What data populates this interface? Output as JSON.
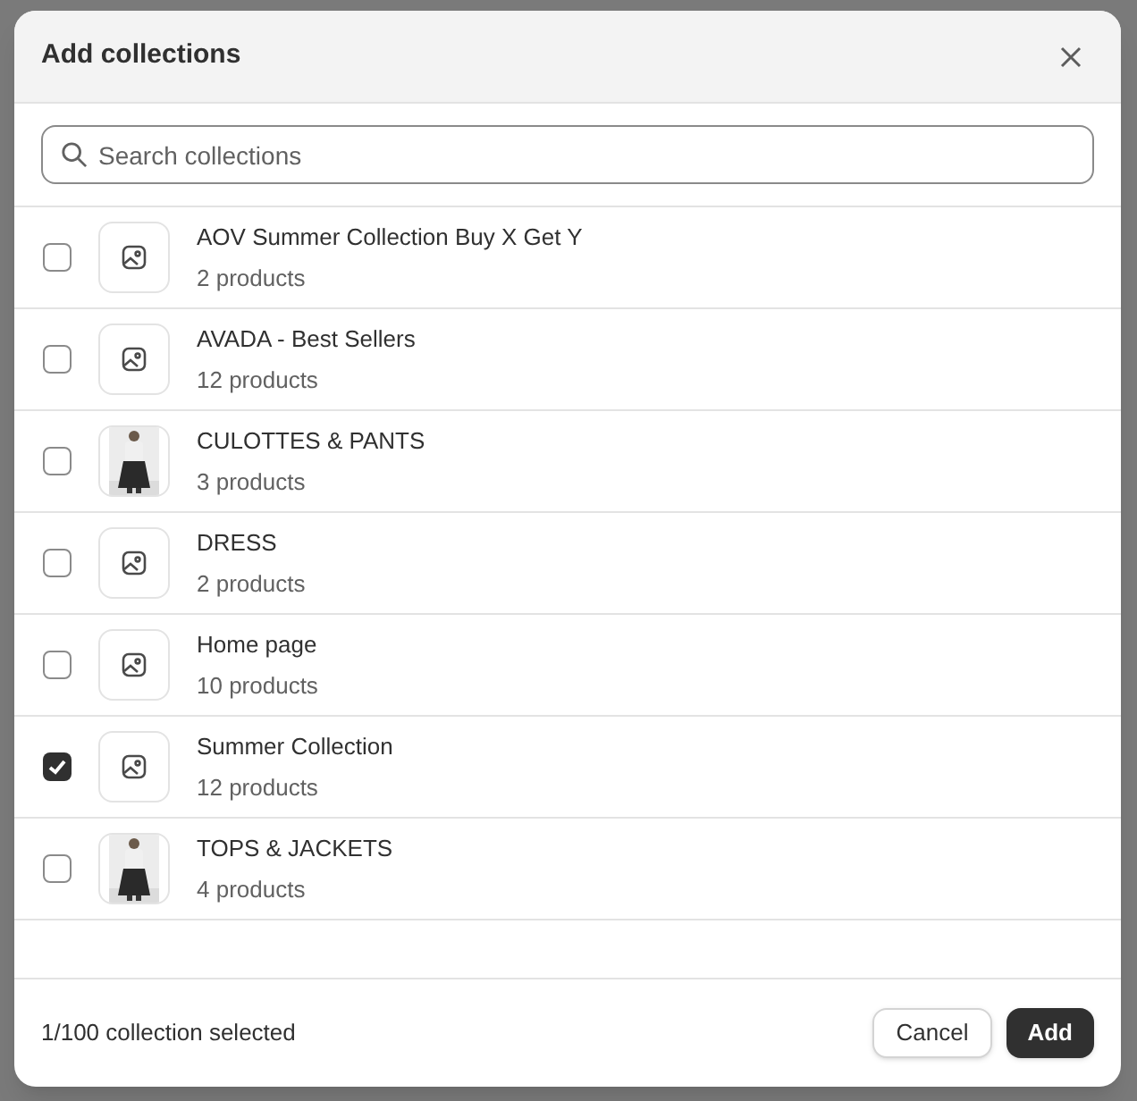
{
  "dialog": {
    "title": "Add collections"
  },
  "search": {
    "placeholder": "Search collections"
  },
  "collections": [
    {
      "name": "AOV Summer Collection Buy X Get Y",
      "count": "2 products",
      "checked": false,
      "kind": "placeholder"
    },
    {
      "name": "AVADA - Best Sellers",
      "count": "12 products",
      "checked": false,
      "kind": "placeholder"
    },
    {
      "name": "CULOTTES & PANTS",
      "count": "3 products",
      "checked": false,
      "kind": "picture"
    },
    {
      "name": "DRESS",
      "count": "2 products",
      "checked": false,
      "kind": "placeholder"
    },
    {
      "name": "Home page",
      "count": "10 products",
      "checked": false,
      "kind": "placeholder"
    },
    {
      "name": "Summer Collection",
      "count": "12 products",
      "checked": true,
      "kind": "placeholder"
    },
    {
      "name": "TOPS & JACKETS",
      "count": "4 products",
      "checked": false,
      "kind": "picture"
    }
  ],
  "footer": {
    "status": "1/100 collection selected",
    "buttons": [
      "Cancel",
      "Add"
    ]
  }
}
